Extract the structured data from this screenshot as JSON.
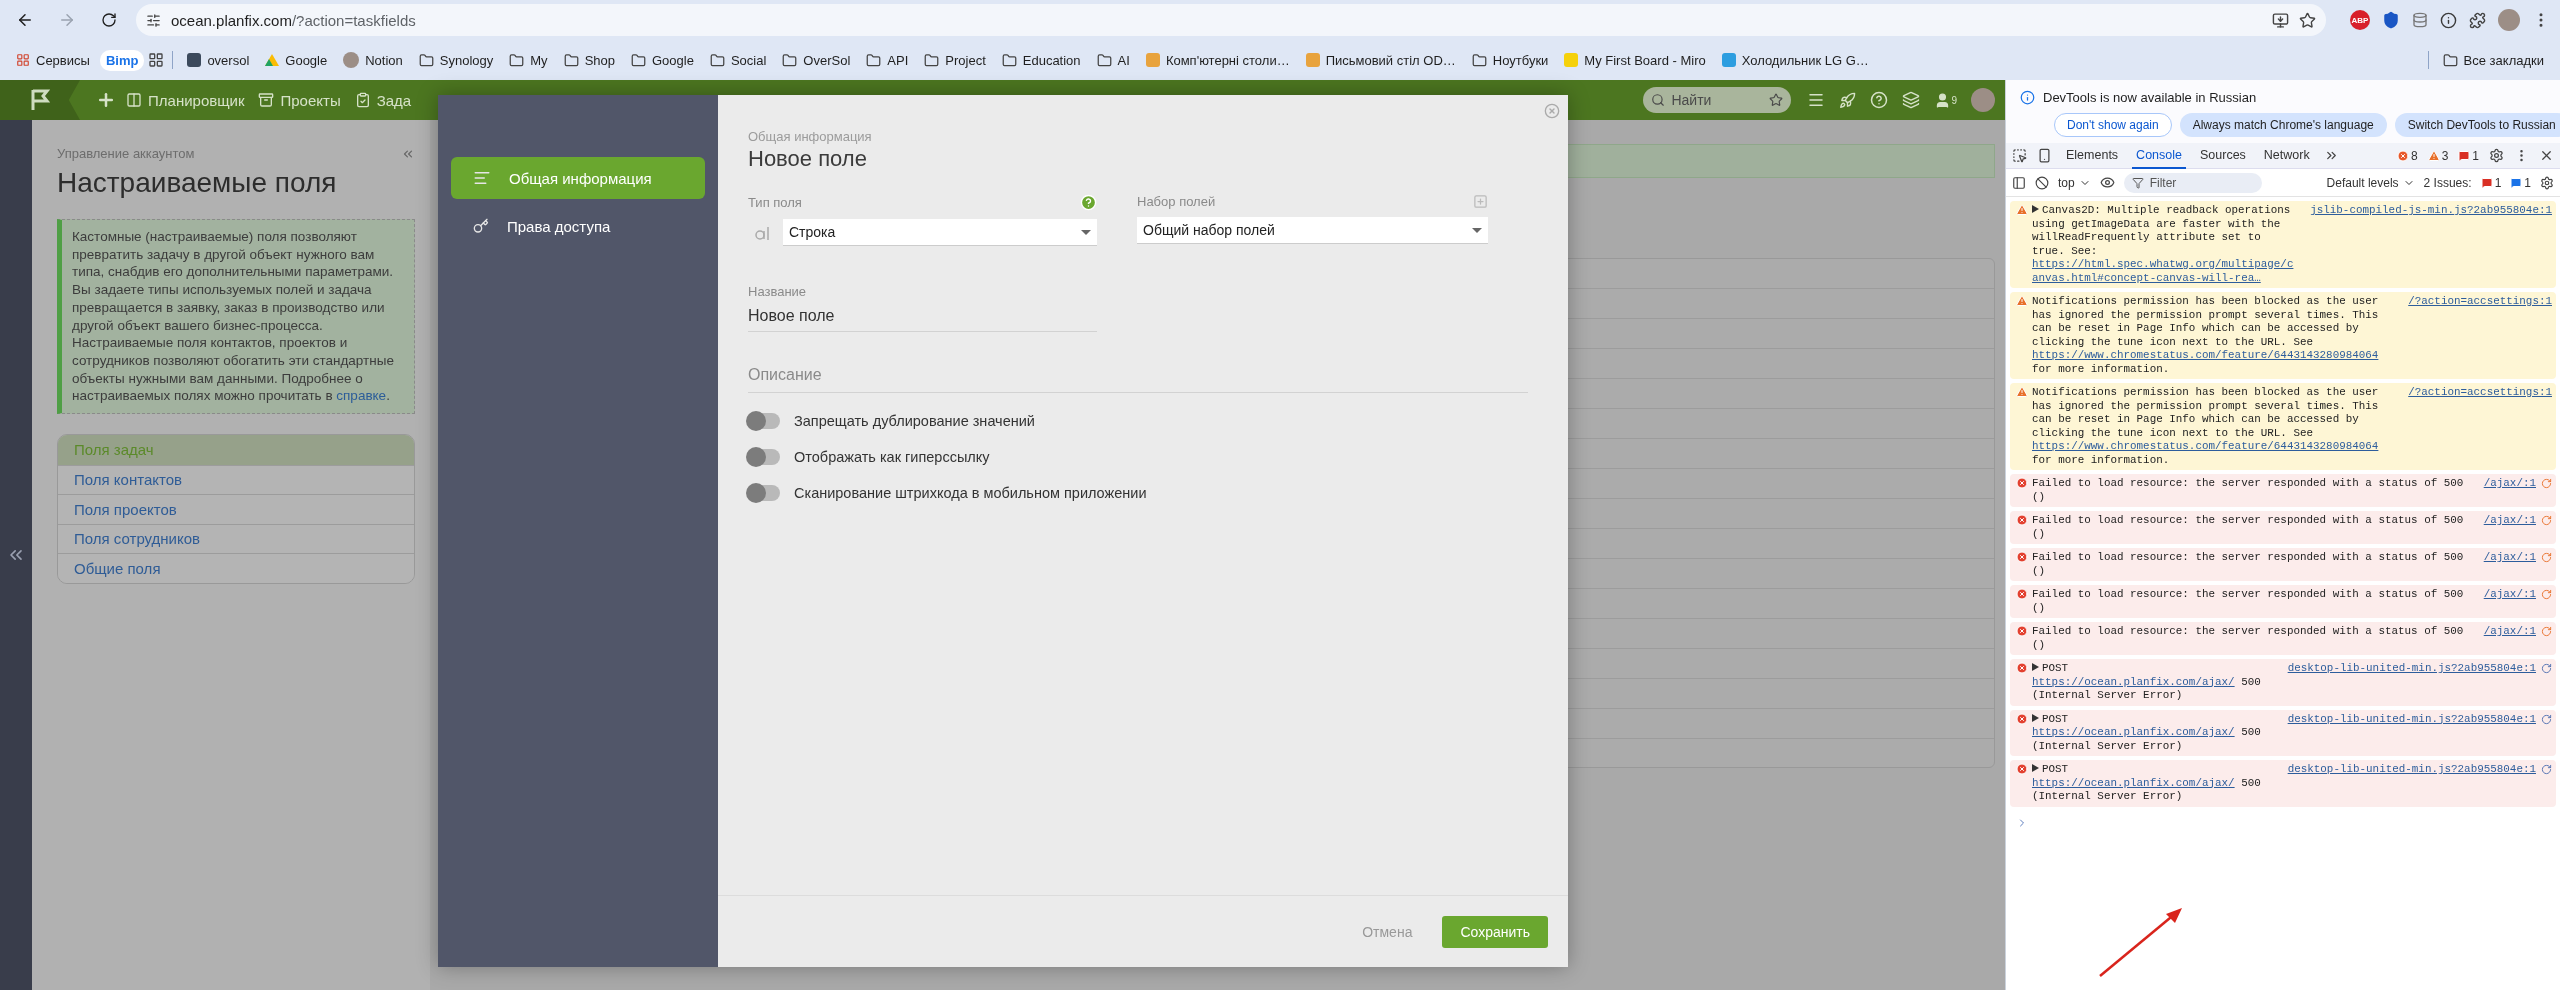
{
  "browser": {
    "url_host": "ocean.planfix.com",
    "url_path": "/?action=taskfields",
    "extension_badge": "ABP",
    "bookmarks": [
      {
        "kind": "apps",
        "label": "Сервисы"
      },
      {
        "kind": "chip",
        "label": "Bimp"
      },
      {
        "kind": "grid"
      },
      {
        "kind": "site",
        "label": "oversol",
        "color": "#3c4a5c"
      },
      {
        "kind": "drive",
        "label": "Google"
      },
      {
        "kind": "avatar",
        "label": "Notion"
      },
      {
        "kind": "folder",
        "label": "Synology"
      },
      {
        "kind": "folder",
        "label": "My"
      },
      {
        "kind": "folder",
        "label": "Shop"
      },
      {
        "kind": "folder",
        "label": "Google"
      },
      {
        "kind": "folder",
        "label": "Social"
      },
      {
        "kind": "folder",
        "label": "OverSol"
      },
      {
        "kind": "folder",
        "label": "API"
      },
      {
        "kind": "folder",
        "label": "Project"
      },
      {
        "kind": "folder",
        "label": "Education"
      },
      {
        "kind": "folder",
        "label": "AI"
      },
      {
        "kind": "site",
        "label": "Комп'ютерні столи…",
        "color": "#e8a33d"
      },
      {
        "kind": "site",
        "label": "Письмовий стіл OD…",
        "color": "#e8a33d"
      },
      {
        "kind": "folder",
        "label": "Ноутбуки"
      },
      {
        "kind": "site",
        "label": "My First Board - Miro",
        "color": "#f5d10a"
      },
      {
        "kind": "site",
        "label": "Холодильник LG G…",
        "color": "#2d9ee0"
      }
    ],
    "all_bookmarks": "Все закладки"
  },
  "header": {
    "nav": [
      {
        "label": "Планировщик"
      },
      {
        "label": "Проекты"
      },
      {
        "label": "Зада"
      }
    ],
    "search_placeholder": "Найти",
    "notifications": "9"
  },
  "account": {
    "breadcrumb": "Управление аккаунтом",
    "title": "Настраиваемые поля",
    "info": {
      "text": "Кастомные (настраиваемые) поля позволяют превратить задачу в другой объект нужного вам типа, снабдив его дополнительными параметрами. Вы задаете типы используемых полей и задача превращается в заявку, заказ в производство или другой объект вашего бизнес-процесса. Настраиваемые поля контактов, проектов и сотрудников позволяют обогатить эти стандартные объекты нужными вам данными. Подробнее о настраиваемых полях можно прочитать в ",
      "link": "справке",
      "end": "."
    },
    "menu": [
      {
        "label": "Поля задач",
        "selected": true
      },
      {
        "label": "Поля контактов",
        "selected": false
      },
      {
        "label": "Поля проектов",
        "selected": false
      },
      {
        "label": "Поля сотрудников",
        "selected": false
      },
      {
        "label": "Общие поля",
        "selected": false
      }
    ]
  },
  "modal": {
    "sidebar": [
      {
        "label": "Общая информация",
        "selected": true
      },
      {
        "label": "Права доступа",
        "selected": false
      }
    ],
    "breadcrumb": "Общая информация",
    "title": "Новое поле",
    "field_type": {
      "label": "Тип поля",
      "value": "Строка"
    },
    "field_set": {
      "label": "Набор полей",
      "value": "Общий набор полей"
    },
    "name": {
      "label": "Название",
      "value": "Новое поле"
    },
    "description": {
      "placeholder": "Описание"
    },
    "toggles": [
      {
        "label": "Запрещать дублирование значений",
        "on": false
      },
      {
        "label": "Отображать как гиперссылку",
        "on": false
      },
      {
        "label": "Сканирование штрихкода в мобильном приложении",
        "on": false
      }
    ],
    "cancel": "Отмена",
    "save": "Сохранить"
  },
  "devtools": {
    "notice": {
      "text": "DevTools is now available in Russian",
      "buttons": [
        "Don't show again",
        "Always match Chrome's language",
        "Switch DevTools to Russian"
      ]
    },
    "tabs": [
      {
        "label": "Elements",
        "selected": false
      },
      {
        "label": "Console",
        "selected": true
      },
      {
        "label": "Sources",
        "selected": false
      },
      {
        "label": "Network",
        "selected": false
      }
    ],
    "counts": {
      "errors": "8",
      "warnings": "3",
      "info": "1"
    },
    "toolbar": {
      "context": "top",
      "filter_placeholder": "Filter",
      "levels": "Default levels",
      "issues_label": "2 Issues:",
      "issues_errors": "1",
      "issues_info": "1"
    },
    "messages": [
      {
        "kind": "warning",
        "expandable": true,
        "text": "Canvas2D: Multiple readback operations using getImageData are faster with the willReadFrequently attribute set to true. See: ",
        "link": "https://html.spec.whatwg.org/multipage/canvas.html#concept-canvas-will-rea…",
        "source": "jslib-compiled-js-min.js?2ab955804e:1"
      },
      {
        "kind": "warning",
        "expandable": false,
        "text": "Notifications permission has been blocked as the user has ignored the permission prompt several times. This can be reset in Page Info which can be accessed by clicking the tune icon next to the URL. See ",
        "link": "https://www.chromestatus.com/feature/6443143280984064",
        "after": " for more information.",
        "source": "/?action=accsettings:1"
      },
      {
        "kind": "warning",
        "expandable": false,
        "text": "Notifications permission has been blocked as the user has ignored the permission prompt several times. This can be reset in Page Info which can be accessed by clicking the tune icon next to the URL. See ",
        "link": "https://www.chromestatus.com/feature/6443143280984064",
        "after": " for more information.",
        "source": "/?action=accsettings:1"
      },
      {
        "kind": "error",
        "expandable": false,
        "text": "Failed to load resource: the server responded with a status of 500 ()",
        "source": "/ajax/:1"
      },
      {
        "kind": "error",
        "expandable": false,
        "text": "Failed to load resource: the server responded with a status of 500 ()",
        "source": "/ajax/:1"
      },
      {
        "kind": "error",
        "expandable": false,
        "text": "Failed to load resource: the server responded with a status of 500 ()",
        "source": "/ajax/:1"
      },
      {
        "kind": "error",
        "expandable": false,
        "text": "Failed to load resource: the server responded with a status of 500 ()",
        "source": "/ajax/:1"
      },
      {
        "kind": "error",
        "expandable": false,
        "text": "Failed to load resource: the server responded with a status of 500 ()",
        "source": "/ajax/:1"
      },
      {
        "kind": "error",
        "expandable": true,
        "text": "POST ",
        "link": "https://ocean.planfix.com/ajax/",
        "after": " 500 (Internal Server Error)",
        "source": "desktop-lib-united-min.js?2ab955804e:1"
      },
      {
        "kind": "error",
        "expandable": true,
        "text": "POST ",
        "link": "https://ocean.planfix.com/ajax/",
        "after": " 500 (Internal Server Error)",
        "source": "desktop-lib-united-min.js?2ab955804e:1"
      },
      {
        "kind": "error",
        "expandable": true,
        "text": "POST ",
        "link": "https://ocean.planfix.com/ajax/",
        "after": " 500 (Internal Server Error)",
        "source": "desktop-lib-united-min.js?2ab955804e:1"
      }
    ]
  }
}
